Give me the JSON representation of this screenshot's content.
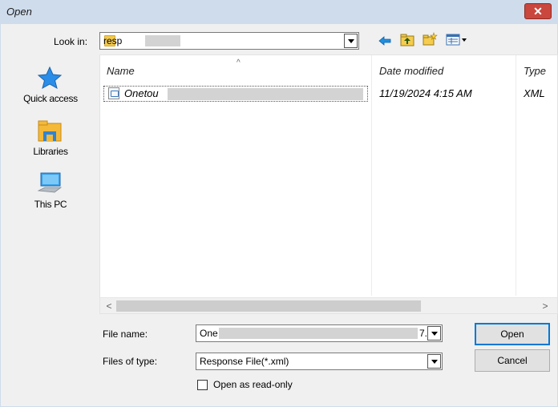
{
  "window": {
    "title": "Open",
    "close_glyph": "✕"
  },
  "lookin": {
    "label": "Look in:",
    "value": "resp",
    "icon": "folder-icon"
  },
  "toolbar": {
    "icons": [
      "back-arrow-icon",
      "up-one-level-icon",
      "new-folder-icon",
      "view-menu-icon"
    ]
  },
  "places": [
    {
      "label": "Quick access",
      "icon": "star-icon"
    },
    {
      "label": "Libraries",
      "icon": "libraries-folder-icon"
    },
    {
      "label": "This PC",
      "icon": "computer-icon"
    }
  ],
  "filelist": {
    "columns": [
      "Name",
      "Date modified",
      "Type"
    ],
    "rows": [
      {
        "name": "Onetou",
        "date": "11/19/2024 4:15 AM",
        "type": "XML"
      }
    ],
    "scroll_left": "<",
    "scroll_right": ">"
  },
  "filename": {
    "label": "File name:",
    "value": "One",
    "value_tail": "7."
  },
  "filetype": {
    "label": "Files of type:",
    "value": "Response File(*.xml)"
  },
  "readonly": {
    "label": "Open as read-only",
    "checked": false
  },
  "buttons": {
    "open": "Open",
    "cancel": "Cancel"
  },
  "colors": {
    "titlebar": "#cfdcec",
    "close": "#c9473d",
    "accent": "#0078d7"
  }
}
